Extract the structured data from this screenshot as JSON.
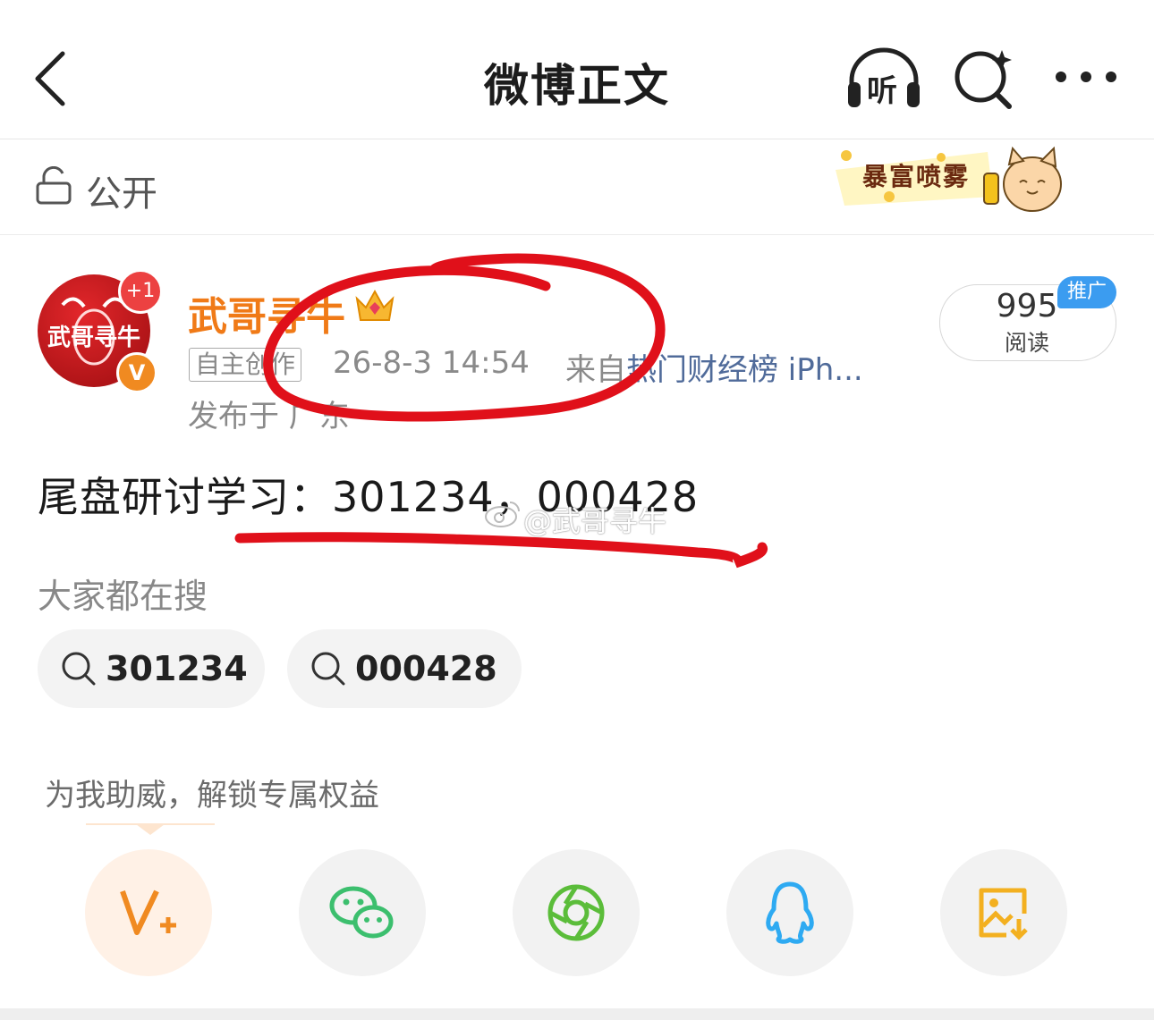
{
  "header": {
    "title": "微博正文",
    "listen_label": "听"
  },
  "visibility": {
    "label": "公开",
    "banner_text": "暴富喷雾"
  },
  "post": {
    "author": {
      "name": "武哥寻牛",
      "avatar_text": "武哥寻牛",
      "notification_badge": "+1",
      "verified_badge": "V"
    },
    "original_tag": "自主创作",
    "timestamp": "26-8-3 14:54",
    "source_prefix": "来自",
    "source": "热门财经榜 iPh...",
    "location": "发布于 广东",
    "reads": {
      "count": "995",
      "label": "阅读",
      "promo_badge": "推广"
    },
    "content": "尾盘研讨学习：301234，000428",
    "watermark": "@武哥寻牛"
  },
  "search_section": {
    "title": "大家都在搜",
    "chips": [
      {
        "label": "301234"
      },
      {
        "label": "000428"
      }
    ]
  },
  "boost": {
    "text": "为我助威，解锁专属权益"
  },
  "share_icons": [
    "v-plus-icon",
    "wechat-icon",
    "moments-icon",
    "qq-icon",
    "save-image-icon"
  ],
  "colors": {
    "username": "#f07a17",
    "source_link": "#506b9a",
    "promo_blue": "#3b9cf0",
    "annotation_red": "#e0101a"
  }
}
